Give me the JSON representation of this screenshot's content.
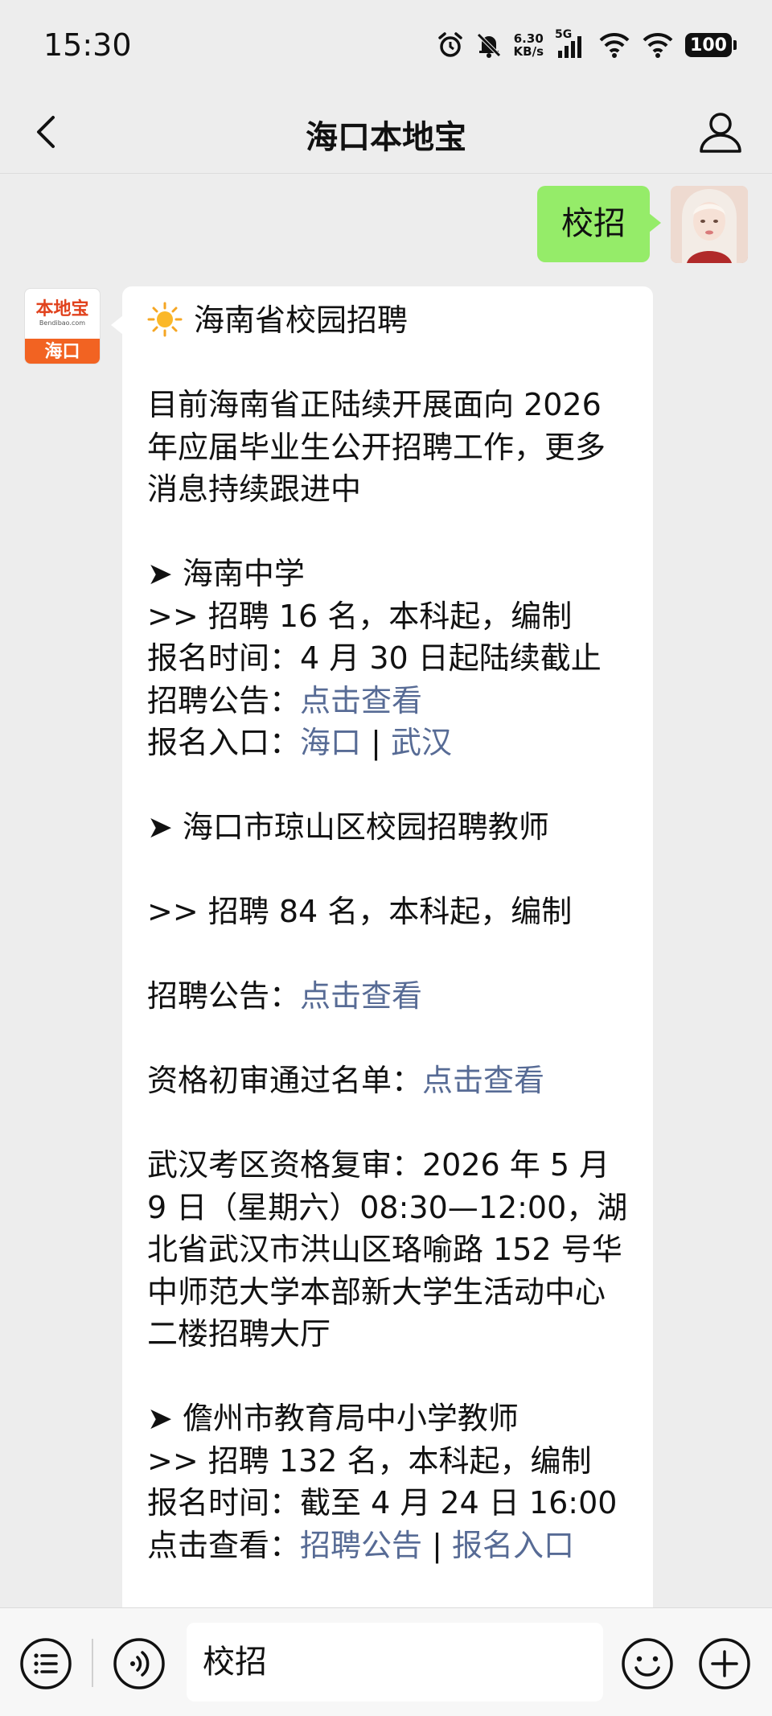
{
  "status_bar": {
    "time": "15:30",
    "net_speed_value": "6.30",
    "net_speed_unit": "KB/s",
    "signal_label": "5G",
    "battery": "100",
    "icons": [
      "alarm-icon",
      "mute-icon",
      "signal-icon",
      "wifi-icon",
      "wifi-icon",
      "battery-icon"
    ]
  },
  "nav": {
    "title": "海口本地宝",
    "icons": [
      "back-icon",
      "profile-icon"
    ]
  },
  "chat": {
    "sent_message": "校招",
    "bot_avatar": {
      "logo_text": "本地宝",
      "logo_sub": "Bendibao.com",
      "city": "海口"
    },
    "reply": {
      "heading": "海南省校园招聘",
      "intro": "目前海南省正陆续开展面向 2026 年应届毕业生公开招聘工作，更多消息持续跟进中",
      "section1": {
        "title": "➤ 海南中学",
        "quota": ">> 招聘 16 名，本科起，编制",
        "deadline": "报名时间：4 月 30 日起陆续截止",
        "notice_label": "招聘公告：",
        "notice_link": "点击查看",
        "entry_label": "报名入口：",
        "entry_link_1": "海口",
        "separator": " | ",
        "entry_link_2": "武汉"
      },
      "section2": {
        "title": "➤ 海口市琼山区校园招聘教师",
        "quota": ">> 招聘 84 名，本科起，编制",
        "notice_label": "招聘公告：",
        "notice_link": "点击查看",
        "list_label": "资格初审通过名单：",
        "list_link": "点击查看",
        "review": "武汉考区资格复审：2026 年 5 月 9 日（星期六）08:30—12:00，湖北省武汉市洪山区珞喻路 152 号华中师范大学本部新大学生活动中心二楼招聘大厅"
      },
      "section3": {
        "title": "➤ 儋州市教育局中小学教师",
        "quota": ">> 招聘 132 名，本科起，编制",
        "deadline": "报名时间：截至 4 月 24 日 16:00",
        "view_label": "点击查看：",
        "link_1": "招聘公告",
        "separator": " | ",
        "link_2": "报名入口"
      }
    }
  },
  "bottom_bar": {
    "input_value": "校招",
    "icons": [
      "menu-list-icon",
      "voice-icon",
      "emoji-icon",
      "plus-icon"
    ]
  }
}
